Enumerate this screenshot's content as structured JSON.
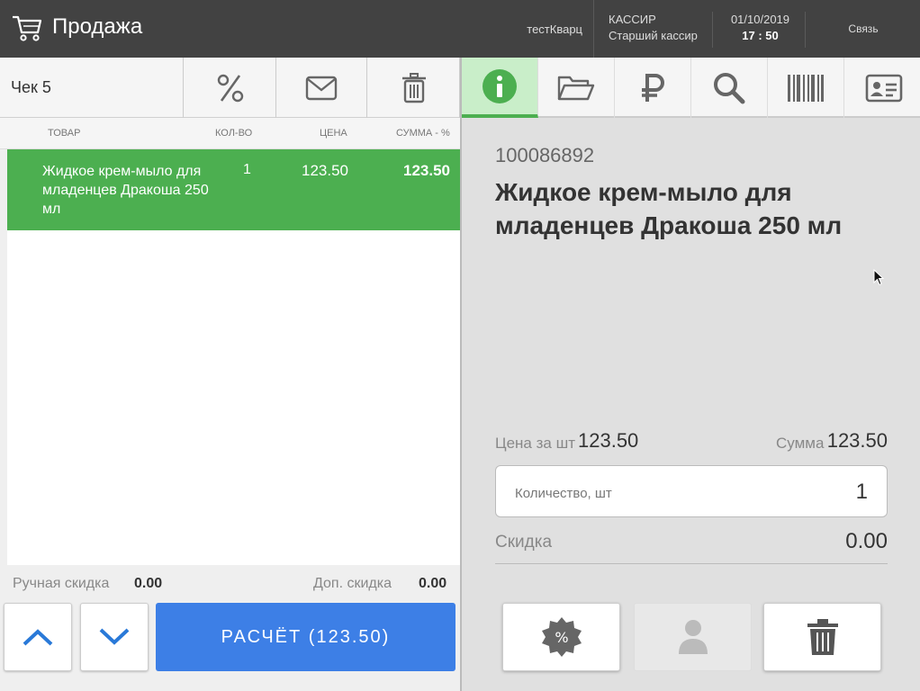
{
  "header": {
    "title": "Продажа",
    "store": "тестКварц",
    "role_label": "КАССИР",
    "role_name": "Старший кассир",
    "date": "01/10/2019",
    "time": "17 : 50",
    "connection": "Связь"
  },
  "receipt": {
    "name": "Чек 5",
    "columns": {
      "product": "ТОВАР",
      "qty": "КОЛ-ВО",
      "price": "ЦЕНА",
      "sum": "СУММА - %"
    },
    "items": [
      {
        "name": "Жидкое крем-мыло для младенцев Дракоша 250 мл",
        "qty": "1",
        "price": "123.50",
        "sum": "123.50"
      }
    ],
    "manual_discount_label": "Ручная скидка",
    "manual_discount_value": "0.00",
    "extra_discount_label": "Доп. скидка",
    "extra_discount_value": "0.00",
    "pay_button": "РАСЧЁТ (123.50)"
  },
  "detail": {
    "code": "100086892",
    "name": "Жидкое крем-мыло для младенцев Дракоша 250 мл",
    "price_label": "Цена за шт",
    "price_value": "123.50",
    "sum_label": "Сумма",
    "sum_value": "123.50",
    "qty_placeholder": "Количество, шт",
    "qty_value": "1",
    "discount_label": "Скидка",
    "discount_value": "0.00"
  },
  "colors": {
    "accent_green": "#4caf50",
    "accent_blue": "#3d7fe6",
    "header_bg": "#424242"
  },
  "icons": {
    "receipt_toolbar": [
      "percent-icon",
      "envelope-icon",
      "trash-icon"
    ],
    "tabs": [
      "info-icon",
      "folder-icon",
      "ruble-icon",
      "search-icon",
      "barcode-icon",
      "id-card-icon"
    ],
    "actions": [
      "discount-badge-icon",
      "person-icon",
      "trash-icon"
    ]
  }
}
